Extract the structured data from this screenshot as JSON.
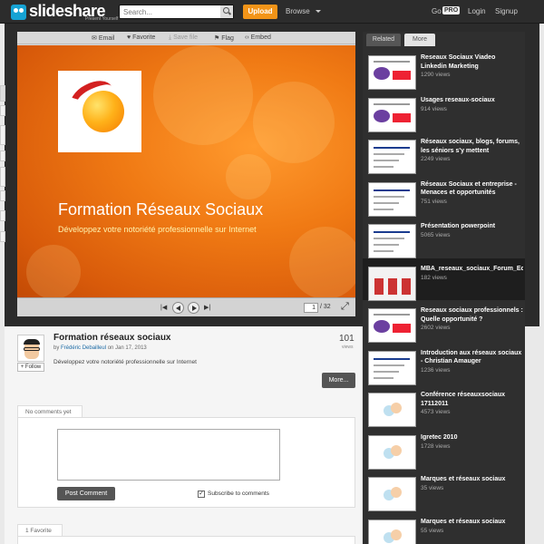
{
  "header": {
    "logo_text": "slideshare",
    "logo_tagline": "Present Yourself",
    "search_placeholder": "Search...",
    "upload_label": "Upload",
    "browse_label": "Browse",
    "go_label": "Go",
    "pro_label": "PRO",
    "login_label": "Login",
    "signup_label": "Signup"
  },
  "player": {
    "tools": {
      "email": "Email",
      "favorite": "Favorite",
      "save": "Save file",
      "flag": "Flag",
      "embed": "Embed"
    },
    "slide_title": "Formation Réseaux Sociaux",
    "slide_subtitle": "Développez votre notoriété professionnelle sur Internet",
    "current_page": "1",
    "total_pages": "/ 32"
  },
  "document": {
    "title": "Formation réseaux sociaux",
    "by": "by",
    "author": "Frédéric Debailleul",
    "date": "on Jan 17, 2013",
    "description": "Développez votre notoriété professionnelle sur Internet",
    "views_count": "101",
    "views_label": "views",
    "follow_label": "+ Follow",
    "more_label": "More..."
  },
  "comments": {
    "tab_label": "No comments yet",
    "post_label": "Post Comment",
    "subscribe_label": "Subscribe to comments",
    "subscribe_checked": true
  },
  "favorites": {
    "tab_label": "1 Favorite"
  },
  "sidebar": {
    "tab_related": "Related",
    "tab_more": "More",
    "items": [
      {
        "title": "Reseaux Sociaux Viadeo Linkedin Marketing",
        "views": "1290 views"
      },
      {
        "title": "Usages reseaux-sociaux",
        "views": "914 views"
      },
      {
        "title": "Réseaux sociaux, blogs, forums, les séniors s'y mettent",
        "views": "2249 views"
      },
      {
        "title": "Réseaux Sociaux et entreprise - Menaces et opportunités",
        "views": "751 views"
      },
      {
        "title": "Présentation powerpoint",
        "views": "5065 views"
      },
      {
        "title": "MBA_reseaux_sociaux_Forum_Ec",
        "views": "182 views"
      },
      {
        "title": "Reseaux sociaux professionnels : Quelle opportunité ?",
        "views": "2602 views"
      },
      {
        "title": "Introduction aux réseaux sociaux - Christian Amauger",
        "views": "1236 views"
      },
      {
        "title": "Conférence réseauxsociaux 17112011",
        "views": "4573 views"
      },
      {
        "title": "Igretec 2010",
        "views": "1728 views"
      },
      {
        "title": "Marques et réseaux sociaux",
        "views": "35 views"
      },
      {
        "title": "Marques et réseaux sociaux",
        "views": "55 views"
      }
    ]
  }
}
